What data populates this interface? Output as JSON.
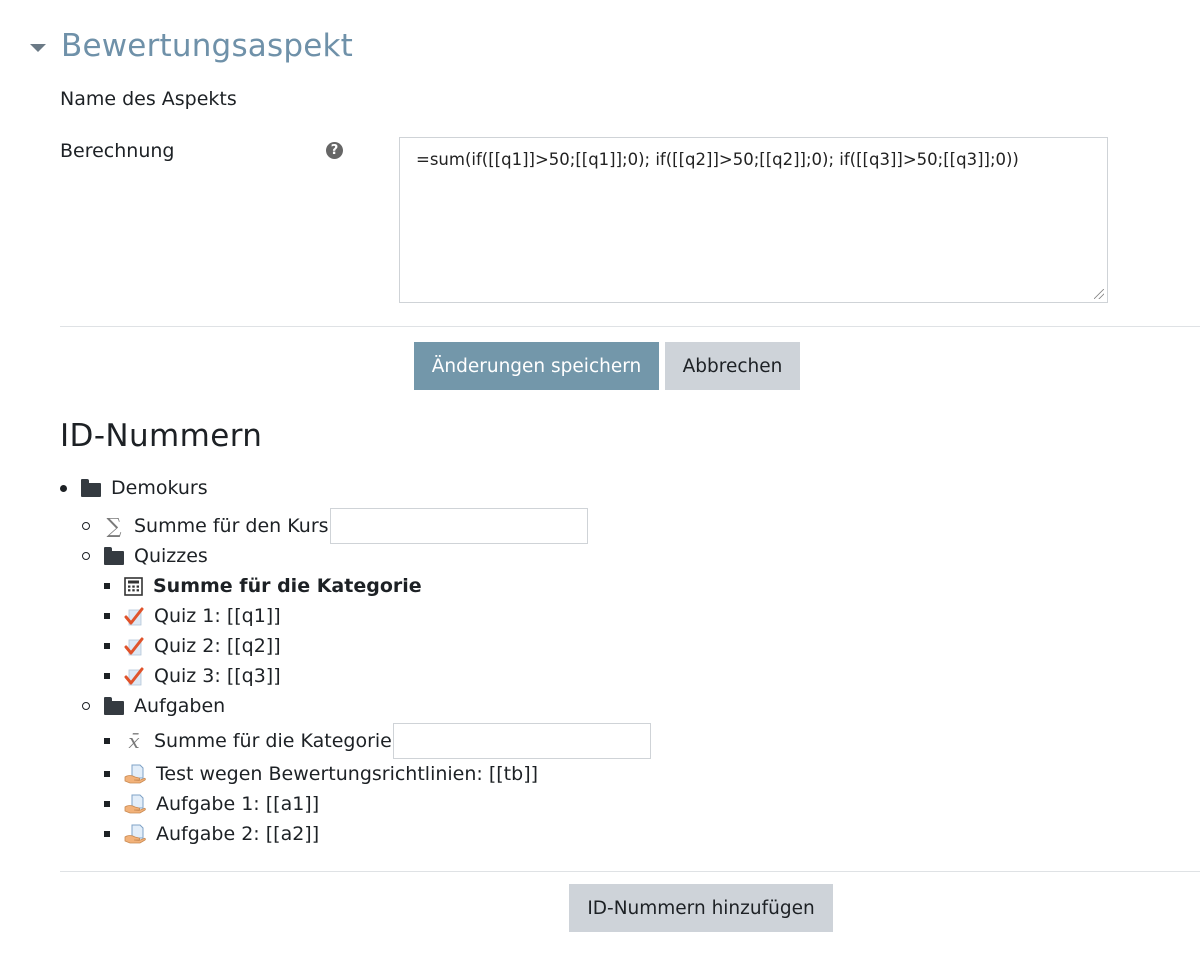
{
  "section": {
    "title": "Bewertungsaspekt",
    "name_label": "Name des Aspekts",
    "calc_label": "Berechnung",
    "calc_value": "=sum(if([[q1]]>50;[[q1]];0); if([[q2]]>50;[[q2]];0); if([[q3]]>50;[[q3]];0))"
  },
  "buttons": {
    "save": "Änderungen speichern",
    "cancel": "Abbrechen",
    "add_ids": "ID-Nummern hinzufügen"
  },
  "idnumbers": {
    "title": "ID-Nummern",
    "course": "Demokurs",
    "course_total": "Summe für den Kurs",
    "course_total_value": "",
    "quizzes": {
      "label": "Quizzes",
      "total": "Summe für die Kategorie",
      "items": [
        "Quiz 1: [[q1]]",
        "Quiz 2: [[q2]]",
        "Quiz 3: [[q3]]"
      ]
    },
    "assignments": {
      "label": "Aufgaben",
      "total": "Summe für die Kategorie",
      "total_value": "",
      "items": [
        "Test wegen Bewertungsrichtlinien: [[tb]]",
        "Aufgabe 1: [[a1]]",
        "Aufgabe 2: [[a2]]"
      ]
    }
  }
}
